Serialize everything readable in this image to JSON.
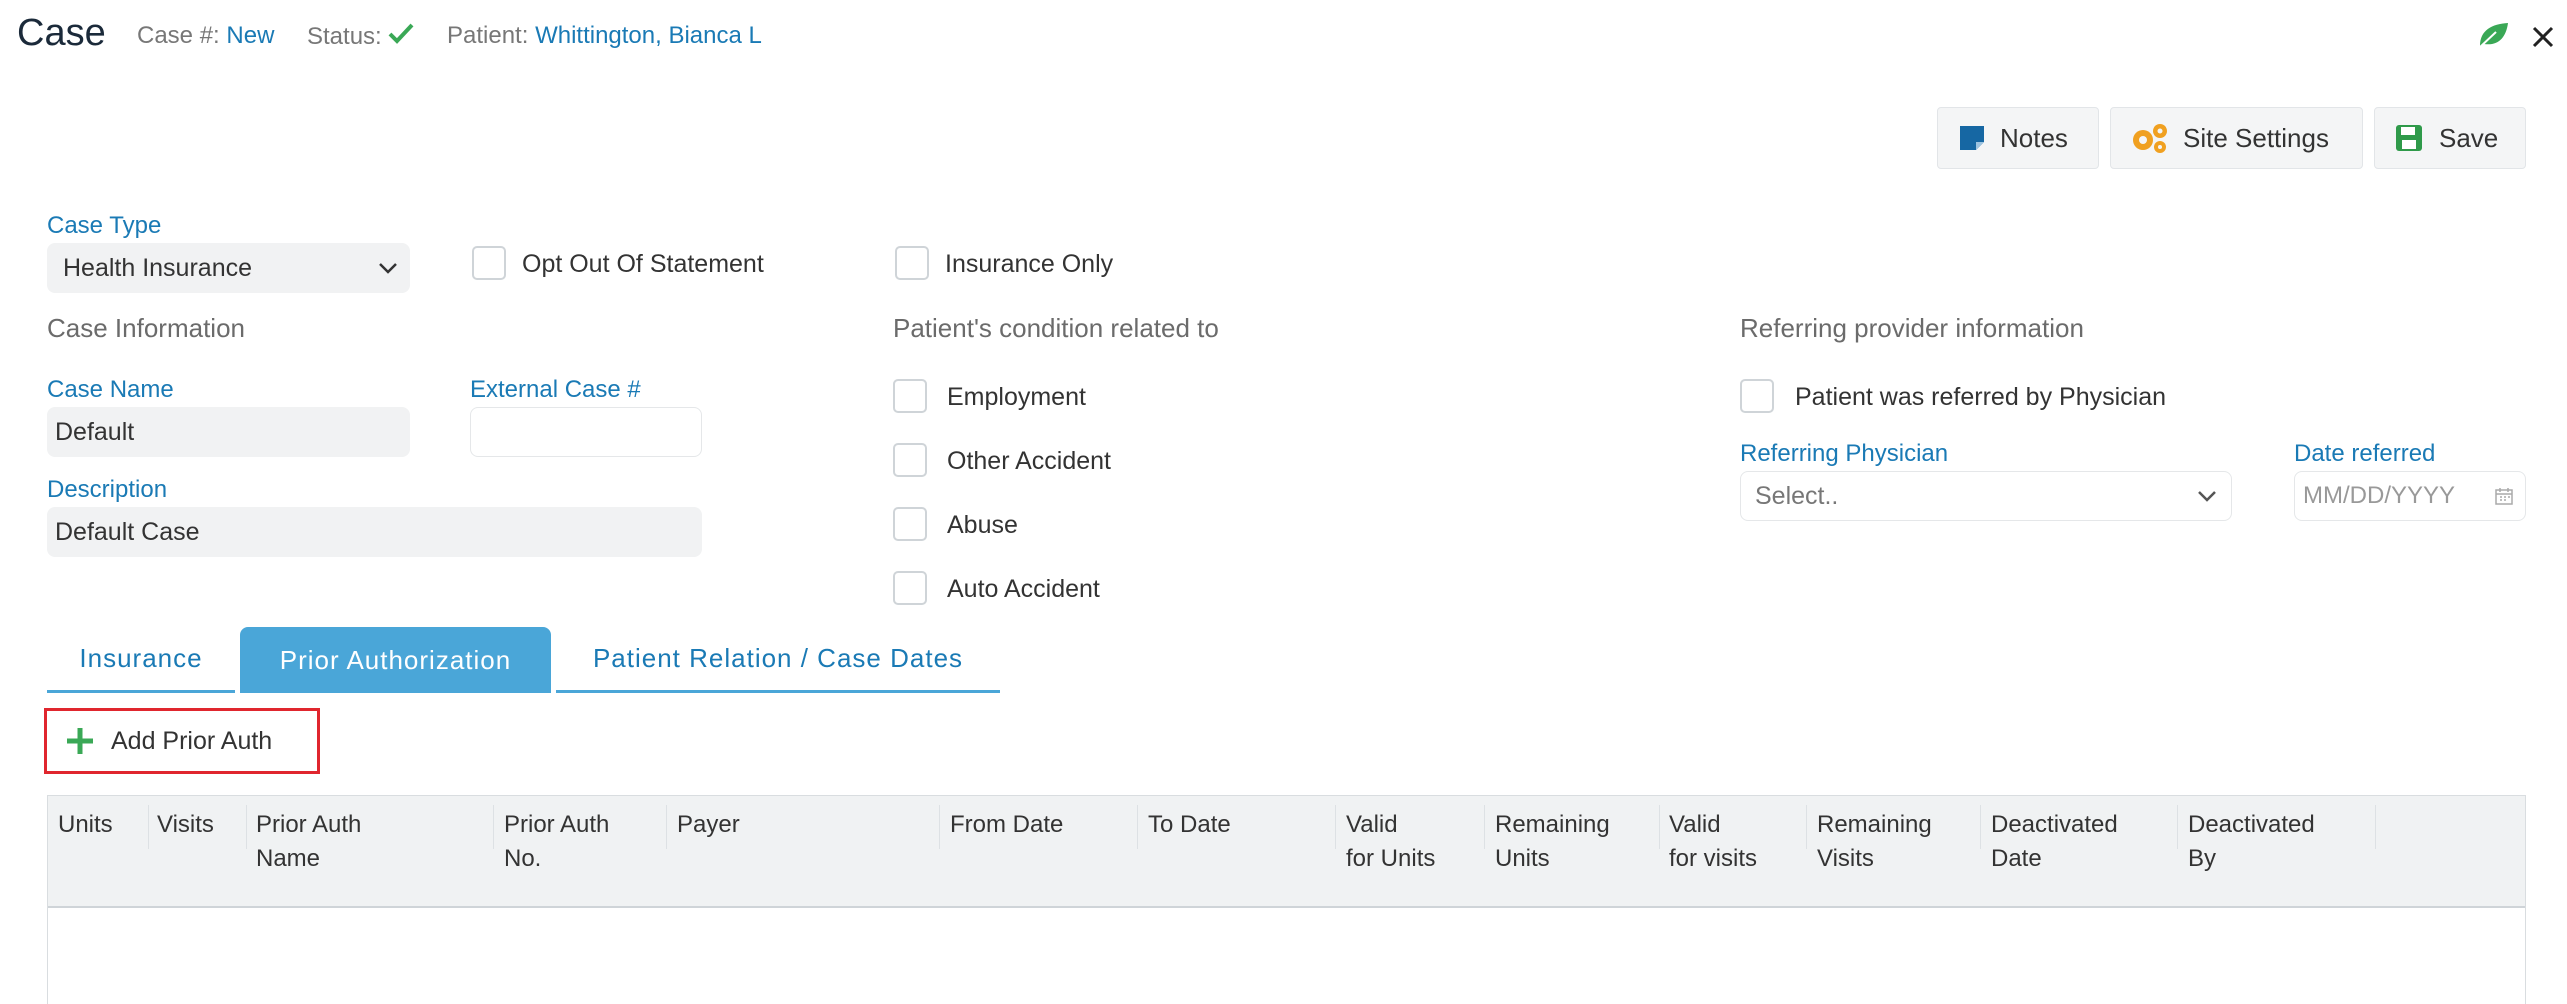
{
  "header": {
    "title": "Case",
    "case_label": "Case #:",
    "case_value": "New",
    "status_label": "Status:",
    "patient_label": "Patient:",
    "patient_value": "Whittington, Bianca L"
  },
  "toolbar": {
    "notes_label": "Notes",
    "site_settings_label": "Site Settings",
    "save_label": "Save"
  },
  "form": {
    "case_type_label": "Case Type",
    "case_type_value": "Health Insurance",
    "opt_out_label": "Opt Out Of Statement",
    "insurance_only_label": "Insurance Only",
    "case_info_heading": "Case Information",
    "case_name_label": "Case Name",
    "case_name_value": "Default",
    "external_case_label": "External Case #",
    "external_case_value": "",
    "description_label": "Description",
    "description_value": "Default Case",
    "condition_heading": "Patient's condition related to",
    "conditions": [
      "Employment",
      "Other Accident",
      "Abuse",
      "Auto Accident"
    ],
    "referring_heading": "Referring provider information",
    "referred_by_physician_label": "Patient was referred by Physician",
    "referring_physician_label": "Referring Physician",
    "referring_physician_placeholder": "Select..",
    "date_referred_label": "Date referred",
    "date_referred_placeholder": "MM/DD/YYYY"
  },
  "tabs": [
    "Insurance",
    "Prior Authorization",
    "Patient Relation / Case Dates"
  ],
  "active_tab": "Prior Authorization",
  "add_prior_auth_label": "Add Prior Auth",
  "table": {
    "columns": [
      [
        "Units"
      ],
      [
        "Visits"
      ],
      [
        "Prior Auth",
        "Name"
      ],
      [
        "Prior Auth",
        "No."
      ],
      [
        "Payer"
      ],
      [
        "From Date"
      ],
      [
        "To Date"
      ],
      [
        "Valid",
        "for Units"
      ],
      [
        "Remaining",
        "Units"
      ],
      [
        "Valid",
        "for visits"
      ],
      [
        "Remaining",
        "Visits"
      ],
      [
        "Deactivated",
        "Date"
      ],
      [
        "Deactivated",
        "By"
      ]
    ],
    "rows": []
  },
  "colors": {
    "accent": "#1a7ab5",
    "active_tab_bg": "#4aa6d8",
    "success": "#3aa856",
    "highlight_border": "#e0262e"
  },
  "icons": [
    "check-icon",
    "leaf-icon",
    "close-icon",
    "notes-icon",
    "gears-icon",
    "save-icon",
    "chevron-down-icon",
    "calendar-icon",
    "plus-icon"
  ]
}
